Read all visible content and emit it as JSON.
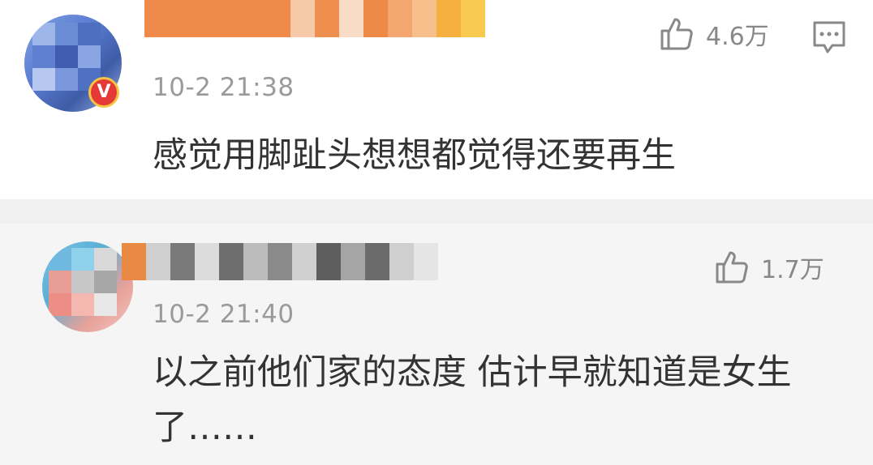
{
  "comments": [
    {
      "time": "10-2 21:38",
      "content": "感觉用脚趾头想想都觉得还要再生",
      "likes": "4.6万",
      "verified_badge": "V",
      "icons": [
        "thumb-up-icon",
        "reply-icon"
      ]
    },
    {
      "time": "10-2 21:40",
      "content_line1": "以之前他们家的态度 估计早就知道是女生",
      "content_line2": "了……",
      "likes": "1.7万",
      "icons": [
        "thumb-up-icon"
      ]
    }
  ],
  "colors": {
    "text_primary": "#333333",
    "text_secondary": "#9a9a9a",
    "icon": "#888888",
    "divider": "#f0f0f0",
    "badge_red": "#e53935",
    "badge_gold": "#f5c542"
  }
}
